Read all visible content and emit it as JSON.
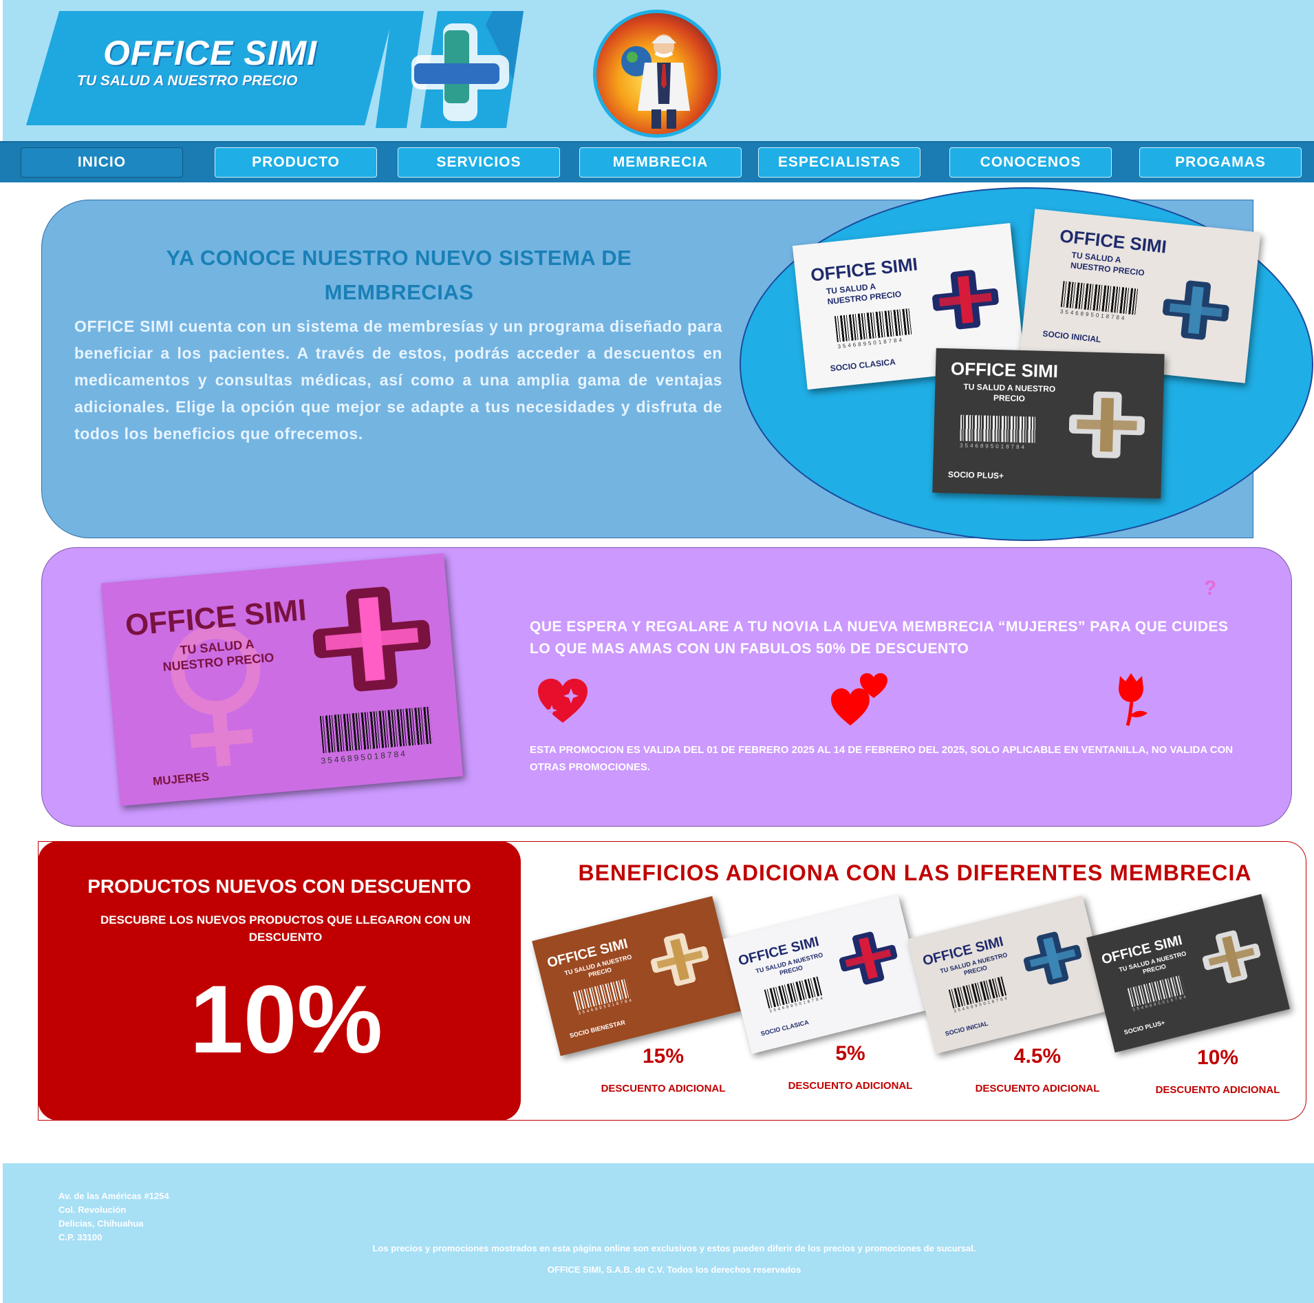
{
  "header": {
    "brand_title": "OFFICE SIMI",
    "brand_tagline": "TU SALUD A NUESTRO PRECIO"
  },
  "nav": {
    "items": [
      {
        "label": "INICIO",
        "active": true
      },
      {
        "label": "PRODUCTO",
        "active": false
      },
      {
        "label": "SERVICIOS",
        "active": false
      },
      {
        "label": "MEMBRECIA",
        "active": false
      },
      {
        "label": "ESPECIALISTAS",
        "active": false
      },
      {
        "label": "CONOCENOS",
        "active": false
      },
      {
        "label": "PROGAMAS",
        "active": false
      }
    ]
  },
  "membership_intro": {
    "title": "YA CONOCE NUESTRO NUEVO SISTEMA DE MEMBRECIAS",
    "body": "OFFICE SIMI cuenta con un sistema de membresías y un programa diseñado para beneficiar a los pacientes. A través de estos, podrás acceder a descuentos en medicamentos y consultas médicas, así como a una amplia gama de ventajas adicionales. Elige la opción que mejor se adapte a tus necesidades y disfruta de todos los beneficios que ofrecemos.",
    "cards": [
      {
        "brand": "OFFICE SIMI",
        "tagline": "TU SALUD A NUESTRO PRECIO",
        "number": "3546895018784",
        "label": "SOCIO CLASICA"
      },
      {
        "brand": "OFFICE SIMI",
        "tagline": "TU SALUD A NUESTRO PRECIO",
        "number": "3546895018784",
        "label": "SOCIO INICIAL"
      },
      {
        "brand": "OFFICE SIMI",
        "tagline": "TU SALUD A NUESTRO PRECIO",
        "number": "3546895018784",
        "label": "SOCIO PLUS+"
      }
    ]
  },
  "women_promo": {
    "card_brand": "OFFICE SIMI",
    "card_tagline": "TU SALUD A NUESTRO PRECIO",
    "card_number": "3546895018784",
    "card_label": "MUJERES",
    "question_mark": "?",
    "headline": "QUE ESPERA Y REGALARE A TU NOVIA LA NUEVA MEMBRECIA “MUJERES” PARA QUE CUIDES LO QUE MAS AMAS CON UN FABULOS 50% DE DESCUENTO",
    "note": "ESTA PROMOCION ES VALIDA DEL 01 DE FEBRERO 2025 AL 14 DE FEBRERO DEL 2025, SOLO APLICABLE EN VENTANILLA, NO VALIDA CON OTRAS PROMOCIONES.",
    "icons": [
      "heart-sparkle-icon",
      "two-hearts-icon",
      "rose-icon"
    ],
    "accent_color": "#ff0000"
  },
  "new_products": {
    "title": "PRODUCTOS NUEVOS CON DESCUENTO",
    "subtitle": "DESCUBRE LOS NUEVOS PRODUCTOS QUE LLEGARON CON UN DESCUENTO",
    "discount": "10%"
  },
  "benefits": {
    "title": "BENEFICIOS ADICIONA CON LAS DIFERENTES MEMBRECIA",
    "items": [
      {
        "card_brand": "OFFICE SIMI",
        "card_tagline": "TU SALUD A NUESTRO PRECIO",
        "card_label": "SOCIO BIENESTAR",
        "card_number": "3546895018784",
        "percent": "15%",
        "label": "DESCUENTO ADICIONAL"
      },
      {
        "card_brand": "OFFICE SIMI",
        "card_tagline": "TU SALUD A NUESTRO PRECIO",
        "card_label": "SOCIO CLASICA",
        "card_number": "3546895018784",
        "percent": "5%",
        "label": "DESCUENTO ADICIONAL"
      },
      {
        "card_brand": "OFFICE SIMI",
        "card_tagline": "TU SALUD A NUESTRO PRECIO",
        "card_label": "SOCIO INICIAL",
        "card_number": "3546895018784",
        "percent": "4.5%",
        "label": "DESCUENTO ADICIONAL"
      },
      {
        "card_brand": "OFFICE SIMI",
        "card_tagline": "TU SALUD A NUESTRO PRECIO",
        "card_label": "SOCIO PLUS+",
        "card_number": "3546895018784",
        "percent": "10%",
        "label": "DESCUENTO ADICIONAL"
      }
    ]
  },
  "footer": {
    "address_lines": [
      "Av. de las Américas #1254",
      "Col. Revolución",
      "Delicias, Chihuahua",
      "C.P. 33100"
    ],
    "disclaimer": "Los precios y promociones mostrados en esta página online son exclusivos y estos pueden diferir de los precios y promociones de sucursal.",
    "copyright": "OFFICE SIMI, S.A.B. de C.V. Todos los derechos reservados"
  },
  "colors": {
    "sky": "#a7dff5",
    "brand_blue": "#1faee5",
    "nav_blue": "#1a7cb3",
    "intro_panel": "#74b4e1",
    "promo_purple": "#cc99ff",
    "discount_red": "#c00000"
  }
}
